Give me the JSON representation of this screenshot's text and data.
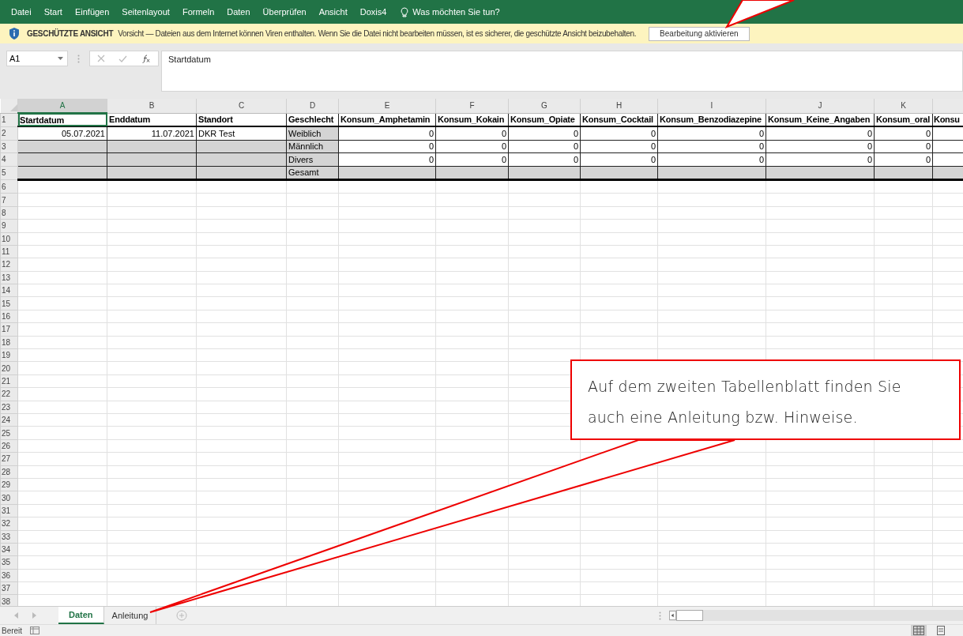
{
  "menu": [
    {
      "label": "Datei"
    },
    {
      "label": "Start"
    },
    {
      "label": "Einfügen"
    },
    {
      "label": "Seitenlayout"
    },
    {
      "label": "Formeln"
    },
    {
      "label": "Daten"
    },
    {
      "label": "Überprüfen"
    },
    {
      "label": "Ansicht"
    },
    {
      "label": "Doxis4"
    }
  ],
  "tell_me": "Was möchten Sie tun?",
  "protected_view": {
    "title": "GESCHÜTZTE ANSICHT",
    "message": "Vorsicht — Dateien aus dem Internet können Viren enthalten. Wenn Sie die Datei nicht bearbeiten müssen, ist es sicherer, die geschützte Ansicht beizubehalten.",
    "button": "Bearbeitung aktivieren"
  },
  "name_box": "A1",
  "formula": "Startdatum",
  "columns": [
    {
      "letter": "A",
      "selected": true
    },
    {
      "letter": "B",
      "selected": false
    },
    {
      "letter": "C",
      "selected": false
    },
    {
      "letter": "D",
      "selected": false
    },
    {
      "letter": "E",
      "selected": false
    },
    {
      "letter": "F",
      "selected": false
    },
    {
      "letter": "G",
      "selected": false
    },
    {
      "letter": "H",
      "selected": false
    },
    {
      "letter": "I",
      "selected": false
    },
    {
      "letter": "J",
      "selected": false
    },
    {
      "letter": "K",
      "selected": false
    },
    {
      "selected": false
    }
  ],
  "rows": [
    {
      "number": "1",
      "cells": [
        {
          "text": "Startdatum",
          "kind": "header",
          "shaded": false,
          "selected": true
        },
        {
          "text": "Enddatum",
          "kind": "header",
          "shaded": false,
          "selected": false
        },
        {
          "text": "Standort",
          "kind": "header",
          "shaded": false,
          "selected": false
        },
        {
          "text": "Geschlecht",
          "kind": "header",
          "shaded": false,
          "selected": false
        },
        {
          "text": "Konsum_Amphetamin",
          "kind": "header",
          "shaded": false,
          "selected": false
        },
        {
          "text": "Konsum_Kokain",
          "kind": "header",
          "shaded": false,
          "selected": false
        },
        {
          "text": "Konsum_Opiate",
          "kind": "header",
          "shaded": false,
          "selected": false
        },
        {
          "text": "Konsum_Cocktail",
          "kind": "header",
          "shaded": false,
          "selected": false
        },
        {
          "text": "Konsum_Benzodiazepine",
          "kind": "header",
          "shaded": false,
          "selected": false
        },
        {
          "text": "Konsum_Keine_Angaben",
          "kind": "header",
          "shaded": false,
          "selected": false
        },
        {
          "text": "Konsum_oral",
          "kind": "header",
          "shaded": false,
          "selected": false
        },
        {
          "text": "Konsu",
          "kind": "header",
          "shaded": false,
          "selected": false
        }
      ]
    },
    {
      "number": "2",
      "cells": [
        {
          "text": "05.07.2021",
          "kind": "number",
          "shaded": false,
          "selected": false
        },
        {
          "text": "11.07.2021",
          "kind": "number",
          "shaded": false,
          "selected": false
        },
        {
          "text": "DKR Test",
          "kind": "text",
          "shaded": false,
          "selected": false
        },
        {
          "text": "Weiblich",
          "kind": "text",
          "shaded": true,
          "selected": false
        },
        {
          "text": "0",
          "kind": "number",
          "shaded": false,
          "selected": false
        },
        {
          "text": "0",
          "kind": "number",
          "shaded": false,
          "selected": false
        },
        {
          "text": "0",
          "kind": "number",
          "shaded": false,
          "selected": false
        },
        {
          "text": "0",
          "kind": "number",
          "shaded": false,
          "selected": false
        },
        {
          "text": "0",
          "kind": "number",
          "shaded": false,
          "selected": false
        },
        {
          "text": "0",
          "kind": "number",
          "shaded": false,
          "selected": false
        },
        {
          "text": "0",
          "kind": "number",
          "shaded": false,
          "selected": false
        },
        {
          "kind": "text",
          "shaded": false,
          "selected": false
        }
      ]
    },
    {
      "number": "3",
      "cells": [
        {
          "kind": "text",
          "shaded": true,
          "selected": false
        },
        {
          "kind": "text",
          "shaded": true,
          "selected": false
        },
        {
          "kind": "text",
          "shaded": true,
          "selected": false
        },
        {
          "text": "Männlich",
          "kind": "text",
          "shaded": true,
          "selected": false
        },
        {
          "text": "0",
          "kind": "number",
          "shaded": false,
          "selected": false
        },
        {
          "text": "0",
          "kind": "number",
          "shaded": false,
          "selected": false
        },
        {
          "text": "0",
          "kind": "number",
          "shaded": false,
          "selected": false
        },
        {
          "text": "0",
          "kind": "number",
          "shaded": false,
          "selected": false
        },
        {
          "text": "0",
          "kind": "number",
          "shaded": false,
          "selected": false
        },
        {
          "text": "0",
          "kind": "number",
          "shaded": false,
          "selected": false
        },
        {
          "text": "0",
          "kind": "number",
          "shaded": false,
          "selected": false
        },
        {
          "kind": "text",
          "shaded": false,
          "selected": false
        }
      ]
    },
    {
      "number": "4",
      "cells": [
        {
          "kind": "text",
          "shaded": true,
          "selected": false
        },
        {
          "kind": "text",
          "shaded": true,
          "selected": false
        },
        {
          "kind": "text",
          "shaded": true,
          "selected": false
        },
        {
          "text": "Divers",
          "kind": "text",
          "shaded": true,
          "selected": false
        },
        {
          "text": "0",
          "kind": "number",
          "shaded": false,
          "selected": false
        },
        {
          "text": "0",
          "kind": "number",
          "shaded": false,
          "selected": false
        },
        {
          "text": "0",
          "kind": "number",
          "shaded": false,
          "selected": false
        },
        {
          "text": "0",
          "kind": "number",
          "shaded": false,
          "selected": false
        },
        {
          "text": "0",
          "kind": "number",
          "shaded": false,
          "selected": false
        },
        {
          "text": "0",
          "kind": "number",
          "shaded": false,
          "selected": false
        },
        {
          "text": "0",
          "kind": "number",
          "shaded": false,
          "selected": false
        },
        {
          "kind": "text",
          "shaded": false,
          "selected": false
        }
      ]
    },
    {
      "number": "5",
      "cells": [
        {
          "kind": "text",
          "shaded": true,
          "selected": false
        },
        {
          "kind": "text",
          "shaded": true,
          "selected": false
        },
        {
          "kind": "text",
          "shaded": true,
          "selected": false
        },
        {
          "text": "Gesamt",
          "kind": "text",
          "shaded": true,
          "selected": false
        },
        {
          "kind": "text",
          "shaded": true,
          "selected": false
        },
        {
          "kind": "text",
          "shaded": true,
          "selected": false
        },
        {
          "kind": "text",
          "shaded": true,
          "selected": false
        },
        {
          "kind": "text",
          "shaded": true,
          "selected": false
        },
        {
          "kind": "text",
          "shaded": true,
          "selected": false
        },
        {
          "kind": "text",
          "shaded": true,
          "selected": false
        },
        {
          "kind": "text",
          "shaded": true,
          "selected": false
        },
        {
          "kind": "text",
          "shaded": true,
          "selected": false
        }
      ]
    },
    {
      "number": "6"
    },
    {
      "number": "7"
    },
    {
      "number": "8"
    },
    {
      "number": "9"
    },
    {
      "number": "10"
    },
    {
      "number": "11"
    },
    {
      "number": "12"
    },
    {
      "number": "13"
    },
    {
      "number": "14"
    },
    {
      "number": "15"
    },
    {
      "number": "16"
    },
    {
      "number": "17"
    },
    {
      "number": "18"
    },
    {
      "number": "19"
    },
    {
      "number": "20"
    },
    {
      "number": "21"
    },
    {
      "number": "22"
    },
    {
      "number": "23"
    },
    {
      "number": "24"
    },
    {
      "number": "25"
    },
    {
      "number": "26"
    },
    {
      "number": "27"
    },
    {
      "number": "28"
    },
    {
      "number": "29"
    },
    {
      "number": "30"
    },
    {
      "number": "31"
    },
    {
      "number": "32"
    },
    {
      "number": "33"
    },
    {
      "number": "34"
    },
    {
      "number": "35"
    },
    {
      "number": "36"
    },
    {
      "number": "37"
    },
    {
      "number": "38"
    }
  ],
  "sheet_tabs": [
    {
      "label": "Daten",
      "selected": true
    },
    {
      "label": "Anleitung",
      "selected": false
    }
  ],
  "status": "Bereit",
  "callout": "Auf dem zweiten Tabellenblatt finden Sie auch eine Anleitung bzw. Hinweise."
}
